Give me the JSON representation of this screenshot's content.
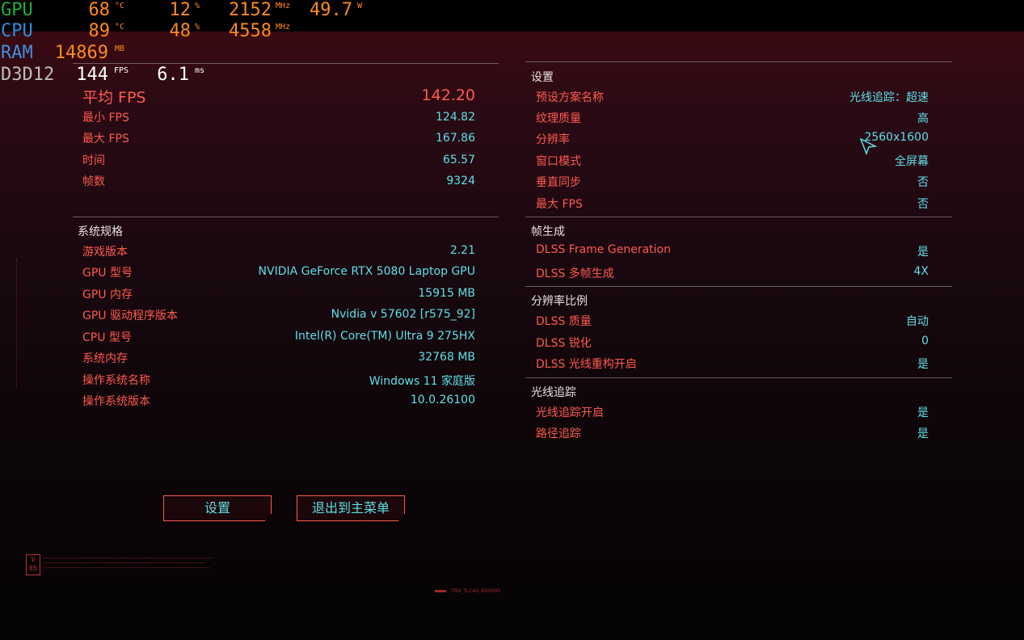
{
  "overlay": {
    "gpu": {
      "label": "GPU",
      "temp": "68",
      "temp_unit": "°C",
      "load": "12",
      "load_unit": "%",
      "clock": "2152",
      "clock_unit": "MHz",
      "power": "49.7",
      "power_unit": "W"
    },
    "cpu": {
      "label": "CPU",
      "temp": "89",
      "temp_unit": "°C",
      "load": "48",
      "load_unit": "%",
      "clock": "4558",
      "clock_unit": "MHz"
    },
    "ram": {
      "label": "RAM",
      "value": "14869",
      "unit": "MB"
    },
    "d3d": {
      "label": "D3D12",
      "fps": "144",
      "fps_unit": "FPS",
      "frametime": "6.1",
      "frametime_unit": "ms"
    }
  },
  "results": {
    "avg_fps_label": "平均 FPS",
    "avg_fps": "142.20",
    "rows": [
      {
        "label": "最小 FPS",
        "value": "124.82"
      },
      {
        "label": "最大 FPS",
        "value": "167.86"
      },
      {
        "label": "时间",
        "value": "65.57"
      },
      {
        "label": "帧数",
        "value": "9324"
      }
    ]
  },
  "system": {
    "title": "系统规格",
    "rows": [
      {
        "label": "游戏版本",
        "value": "2.21"
      },
      {
        "label": "GPU 型号",
        "value": "NVIDIA GeForce RTX 5080 Laptop GPU"
      },
      {
        "label": "GPU 内存",
        "value": "15915 MB"
      },
      {
        "label": "GPU 驱动程序版本",
        "value": "Nvidia v 57602 [r575_92]"
      },
      {
        "label": "CPU 型号",
        "value": "Intel(R) Core(TM) Ultra 9 275HX"
      },
      {
        "label": "系统内存",
        "value": "32768 MB"
      },
      {
        "label": "操作系统名称",
        "value": "Windows 11 家庭版"
      },
      {
        "label": "操作系统版本",
        "value": "10.0.26100"
      }
    ]
  },
  "settings": {
    "title": "设置",
    "rows": [
      {
        "label": "预设方案名称",
        "value": "光线追踪：超速"
      },
      {
        "label": "纹理质量",
        "value": "高"
      },
      {
        "label": "分辨率",
        "value": "2560x1600"
      },
      {
        "label": "窗口模式",
        "value": "全屏幕"
      },
      {
        "label": "垂直同步",
        "value": "否"
      },
      {
        "label": "最大 FPS",
        "value": "否"
      }
    ]
  },
  "frame_gen": {
    "title": "帧生成",
    "rows": [
      {
        "label": "DLSS Frame Generation",
        "value": "是"
      },
      {
        "label": "DLSS 多帧生成",
        "value": "4X"
      }
    ]
  },
  "res_scale": {
    "title": "分辨率比例",
    "rows": [
      {
        "label": "DLSS 质量",
        "value": "自动"
      },
      {
        "label": "DLSS 锐化",
        "value": "0"
      },
      {
        "label": "DLSS 光线重构开启",
        "value": "是"
      }
    ]
  },
  "raytracing": {
    "title": "光线追踪",
    "rows": [
      {
        "label": "光线追踪开启",
        "value": "是"
      },
      {
        "label": "路径追踪",
        "value": "是"
      }
    ]
  },
  "buttons": {
    "settings": "设置",
    "exit": "退出到主菜单"
  },
  "decor": {
    "version_badge": "V 85",
    "footer_code": "TRN_TLCAS_6D0095"
  }
}
